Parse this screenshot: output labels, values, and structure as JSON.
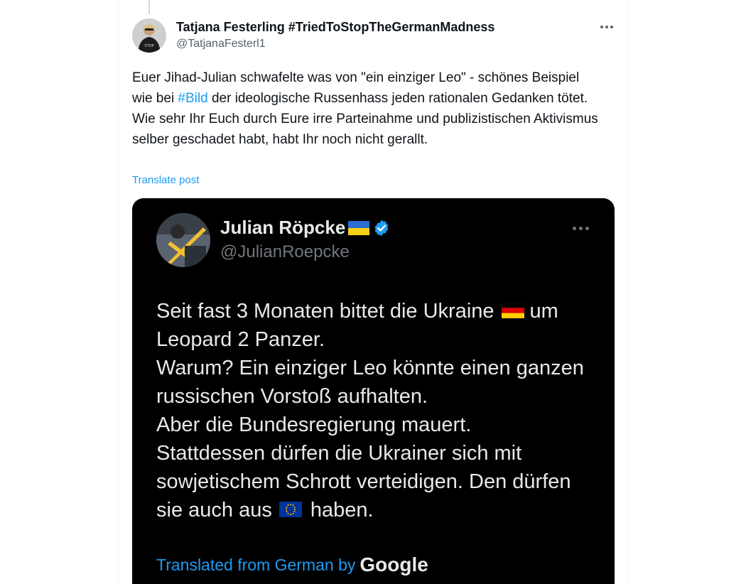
{
  "post": {
    "author_name": "Tatjana Festerling #TriedToStopTheGermanMadness",
    "author_handle": "@TatjanaFesterl1",
    "text_part1": "Euer Jihad-Julian schwafelte was von \"ein einziger Leo\" - schönes Beispiel wie bei ",
    "hashtag": "#Bild",
    "text_part2": " der ideologische Russenhass jeden rationalen Gedanken tötet. Wie sehr Ihr Euch durch Eure irre Parteinahme und publizistischen Aktivismus selber geschadet habt, habt Ihr noch nicht gerallt.",
    "translate_label": "Translate post"
  },
  "quoted": {
    "name": "Julian Röpcke",
    "handle": "@JulianRoepcke",
    "line1a": "Seit fast 3 Monaten bittet die Ukraine",
    "line1b": "um",
    "line2": "Leopard 2 Panzer.",
    "line3": "Warum? Ein einziger Leo könnte einen ganzen",
    "line4": "russischen Vorstoß aufhalten.",
    "line5": "Aber die Bundesregierung mauert.",
    "line6": "Stattdessen dürfen die Ukrainer sich mit",
    "line7": "sowjetischem Schrott verteidigen. Den dürfen",
    "line8a": "sie auch aus",
    "line8b": "haben.",
    "translated_label": "Translated from German by",
    "translated_provider": "Google"
  },
  "icons": {
    "more": "more-horizontal-icon",
    "verified": "verified-badge-icon",
    "flag_ukraine": "ukraine-flag-icon",
    "flag_germany": "germany-flag-icon",
    "flag_eu": "eu-flag-icon"
  },
  "colors": {
    "link": "#1d9bf0",
    "text": "#0f1419",
    "secondary": "#536471",
    "media_bg": "#000000"
  }
}
